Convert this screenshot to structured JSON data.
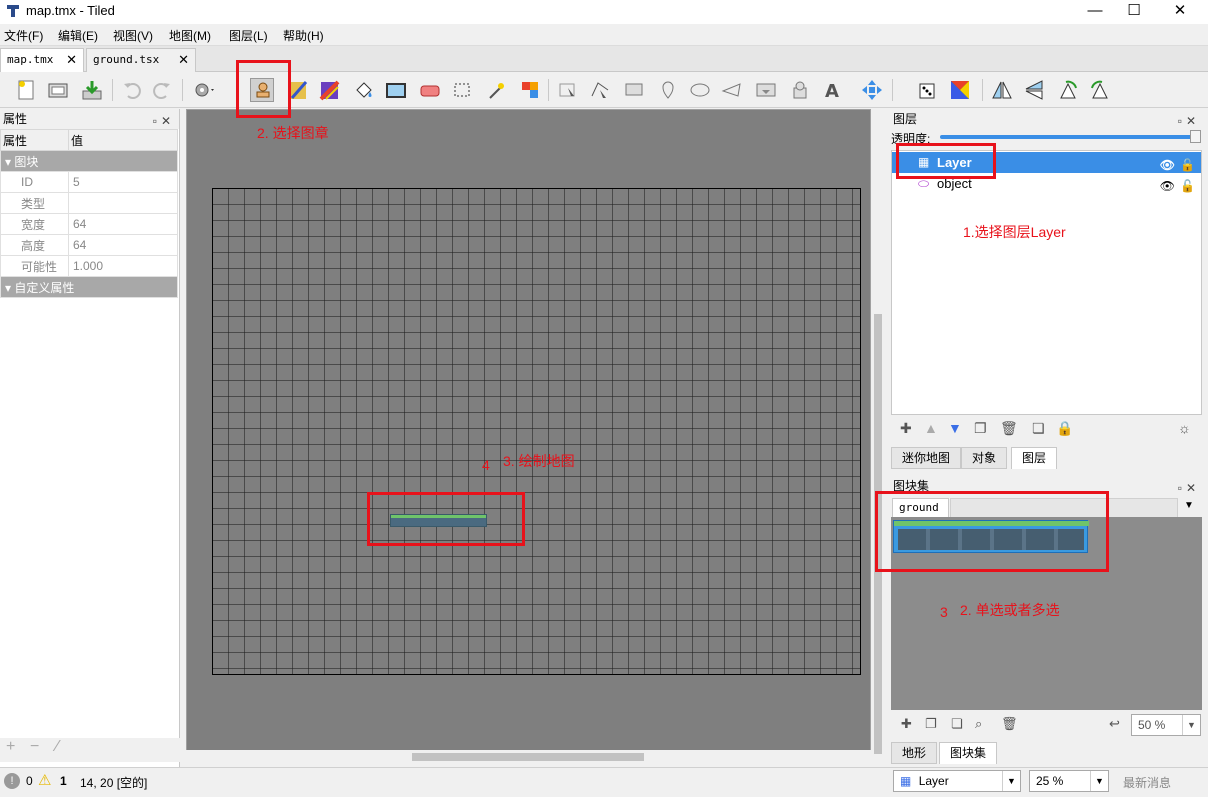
{
  "window": {
    "title": "map.tmx - Tiled",
    "minimize": "—",
    "maximize": "☐",
    "close": "✕"
  },
  "menu": [
    "文件(F)",
    "编辑(E)",
    "视图(V)",
    "地图(M)",
    "图层(L)",
    "帮助(H)"
  ],
  "doc_tabs": [
    {
      "label": "map.tmx",
      "active": true,
      "close": "✕"
    },
    {
      "label": "ground.tsx",
      "active": false,
      "close": "✕"
    }
  ],
  "properties": {
    "title": "属性",
    "col_name": "属性",
    "col_value": "值",
    "group_tile": "图块",
    "rows": [
      {
        "key": "ID",
        "value": "5"
      },
      {
        "key": "类型",
        "value": ""
      },
      {
        "key": "宽度",
        "value": "64"
      },
      {
        "key": "高度",
        "value": "64"
      },
      {
        "key": "可能性",
        "value": "1.000"
      }
    ],
    "group_custom": "自定义属性"
  },
  "layers_panel": {
    "title": "图层",
    "opacity_label": "透明度:",
    "opacity": 1.0,
    "layers": [
      {
        "name": "Layer",
        "selected": true
      },
      {
        "name": "object",
        "selected": false
      }
    ],
    "tabs": [
      "迷你地图",
      "对象",
      "图层"
    ],
    "active_tab": "图层"
  },
  "tileset_panel": {
    "title": "图块集",
    "tileset_tab": "ground",
    "zoom": "50 %",
    "bottom_tabs": [
      "地形",
      "图块集"
    ]
  },
  "annotations": {
    "step1": "1.选择图层Layer",
    "step2": "2. 选择图章",
    "step3_num": "3",
    "step3": "2. 单选或者多选",
    "step4_num": "4",
    "step4": "3. 绘制地图"
  },
  "status": {
    "errors": "0",
    "warnings": "1",
    "position": "14, 20 [空的]",
    "layer_combo": "Layer",
    "zoom": "25 %",
    "news": "最新消息"
  },
  "colors": {
    "highlight": "#3a8ee6",
    "annotation": "#e8121b",
    "canvas": "#7f7f7f"
  }
}
